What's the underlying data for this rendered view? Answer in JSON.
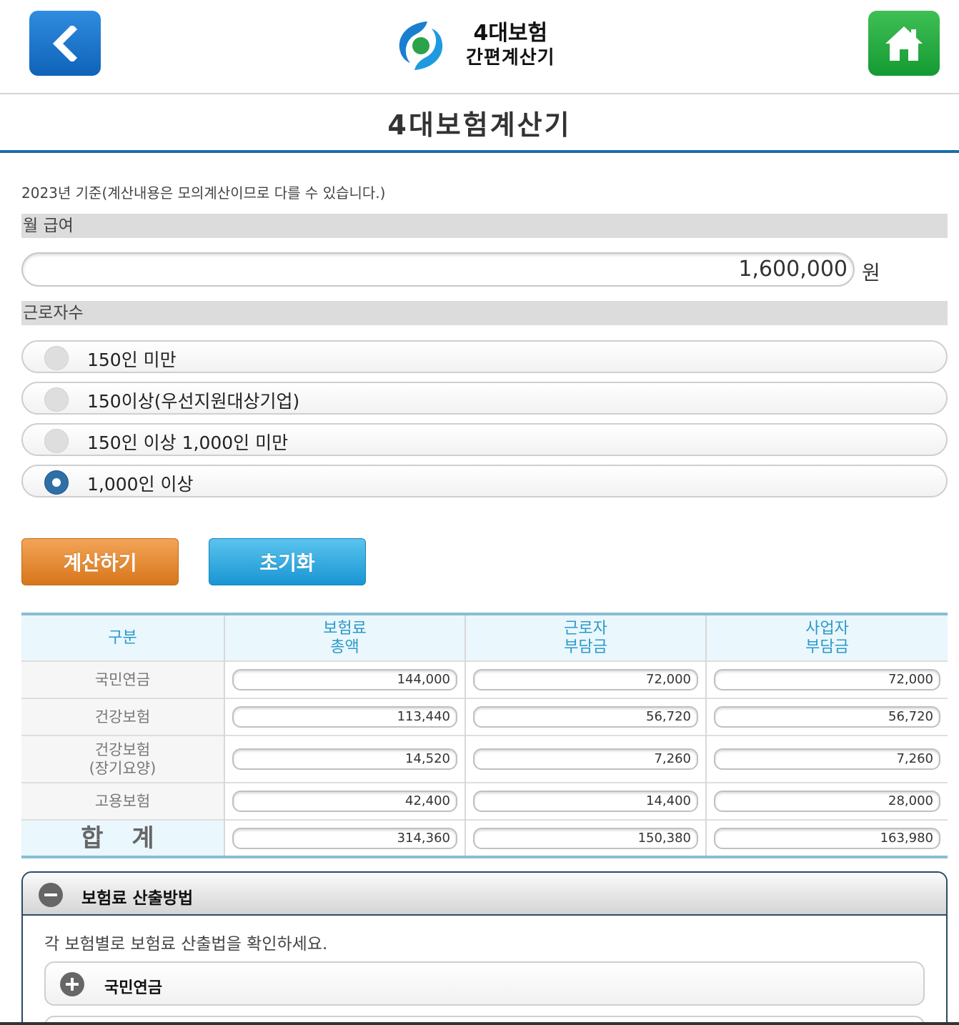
{
  "header": {
    "logo_line1": "4대보험",
    "logo_line2": "간편계산기",
    "back_icon": "chevron-left-icon",
    "home_icon": "home-icon",
    "back_color": "#1f7bd0",
    "home_color": "#27ad44"
  },
  "page_title": "4대보험계산기",
  "note": "2023년 기준(계산내용은 모의계산이므로 다를 수 있습니다.)",
  "salary": {
    "label": "월 급여",
    "value": "1,600,000",
    "unit": "원"
  },
  "workers": {
    "label": "근로자수",
    "options": [
      {
        "label": "150인 미만",
        "checked": false
      },
      {
        "label": "150이상(우선지원대상기업)",
        "checked": false
      },
      {
        "label": "150인 이상 1,000인 미만",
        "checked": false
      },
      {
        "label": "1,000인 이상",
        "checked": true
      }
    ]
  },
  "buttons": {
    "calculate": "계산하기",
    "reset": "초기화",
    "calculate_color": "#e0842c",
    "reset_color": "#2aa6df"
  },
  "table": {
    "headers": [
      "구분",
      "보험료\n총액",
      "근로자\n부담금",
      "사업자\n부담금"
    ],
    "rows": [
      {
        "label": "국민연금",
        "total": "144,000",
        "employee": "72,000",
        "employer": "72,000"
      },
      {
        "label": "건강보험",
        "total": "113,440",
        "employee": "56,720",
        "employer": "56,720"
      },
      {
        "label": "건강보험\n(장기요양)",
        "total": "14,520",
        "employee": "7,260",
        "employer": "7,260"
      },
      {
        "label": "고용보험",
        "total": "42,400",
        "employee": "14,400",
        "employer": "28,000"
      }
    ],
    "total": {
      "label": "합 계",
      "total": "314,360",
      "employee": "150,380",
      "employer": "163,980"
    }
  },
  "method": {
    "title": "보험료 산출방법",
    "description": "각 보험별로 보험료 산출법을 확인하세요.",
    "items": [
      "국민연금"
    ]
  }
}
